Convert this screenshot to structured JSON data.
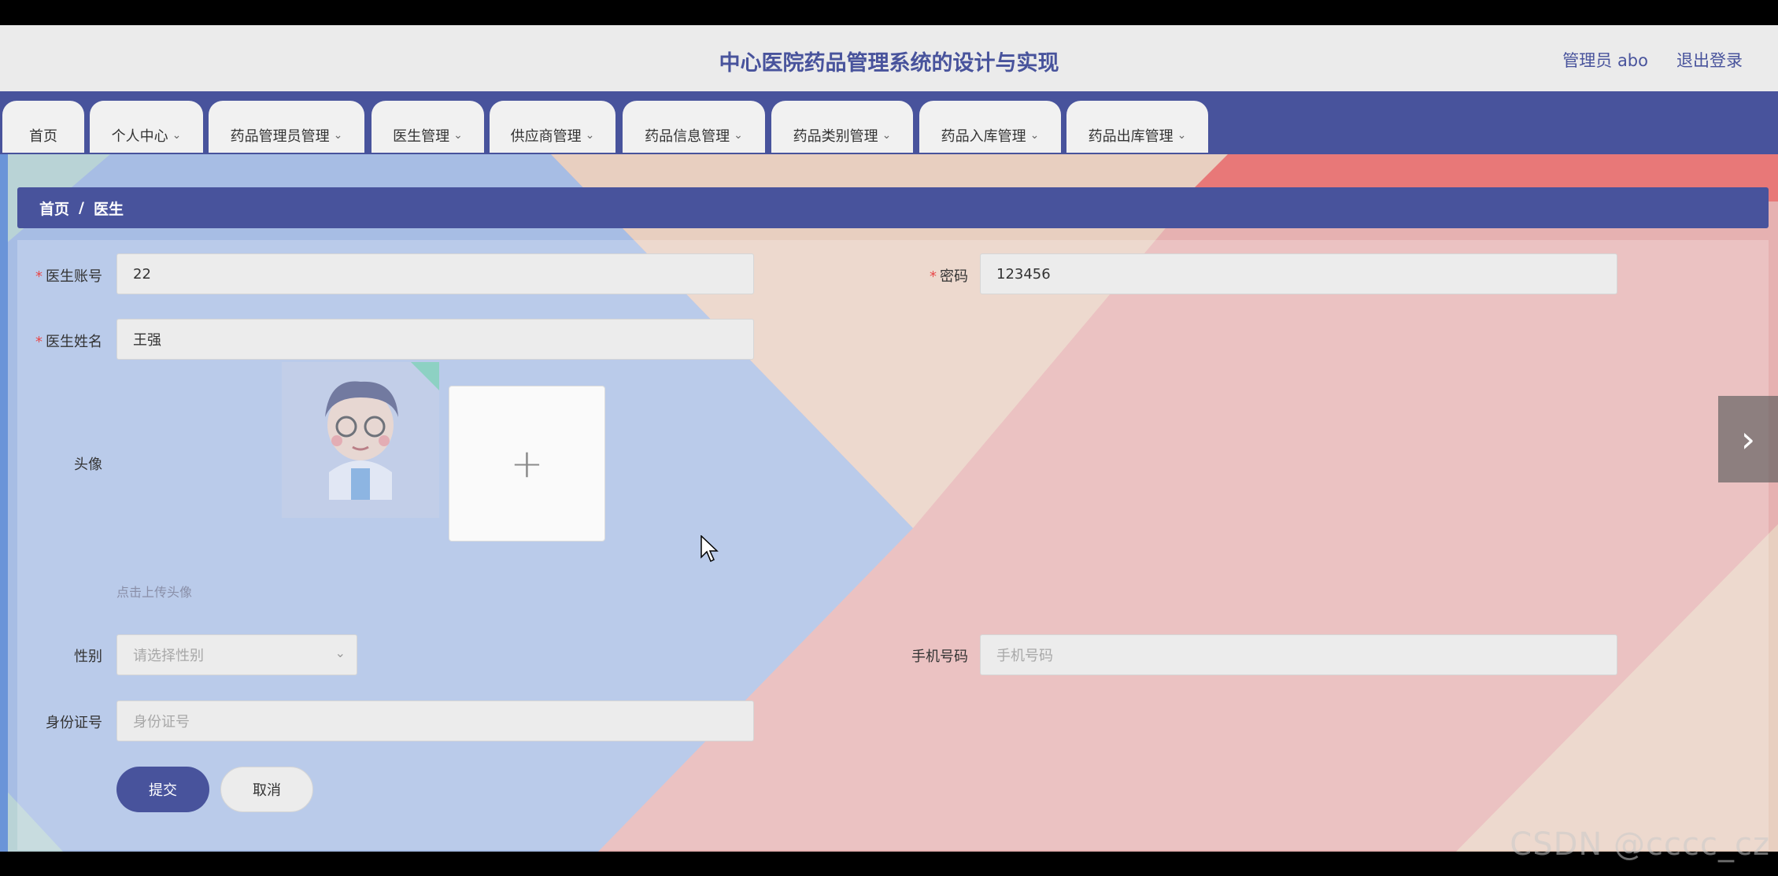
{
  "header": {
    "title": "中心医院药品管理系统的设计与实现",
    "user_label": "管理员 abo",
    "logout_label": "退出登录"
  },
  "nav": {
    "items": [
      {
        "label": "首页",
        "has_dropdown": false
      },
      {
        "label": "个人中心",
        "has_dropdown": true
      },
      {
        "label": "药品管理员管理",
        "has_dropdown": true
      },
      {
        "label": "医生管理",
        "has_dropdown": true
      },
      {
        "label": "供应商管理",
        "has_dropdown": true
      },
      {
        "label": "药品信息管理",
        "has_dropdown": true
      },
      {
        "label": "药品类别管理",
        "has_dropdown": true
      },
      {
        "label": "药品入库管理",
        "has_dropdown": true
      },
      {
        "label": "药品出库管理",
        "has_dropdown": true
      }
    ],
    "chevron": "⌄"
  },
  "breadcrumb": {
    "home": "首页",
    "separator": "/",
    "current": "医生"
  },
  "form": {
    "account": {
      "label": "医生账号",
      "value": "22",
      "required": true
    },
    "password": {
      "label": "密码",
      "value": "123456",
      "required": true
    },
    "name": {
      "label": "医生姓名",
      "value": "王强",
      "required": true
    },
    "avatar": {
      "label": "头像",
      "hint": "点击上传头像",
      "upload_icon": "+"
    },
    "gender": {
      "label": "性别",
      "placeholder": "请选择性别"
    },
    "phone": {
      "label": "手机号码",
      "placeholder": "手机号码"
    },
    "idcard": {
      "label": "身份证号",
      "placeholder": "身份证号"
    },
    "required_mark": "*",
    "submit_label": "提交",
    "cancel_label": "取消"
  },
  "carousel": {
    "next_icon": "›"
  },
  "watermark": "CSDN @cccc_cz",
  "colors": {
    "primary": "#48539c",
    "required": "#e8484a",
    "bg_blue": "#a7bde4",
    "bg_pink": "#e6b1b1",
    "bg_peach": "#e8cfc0"
  }
}
